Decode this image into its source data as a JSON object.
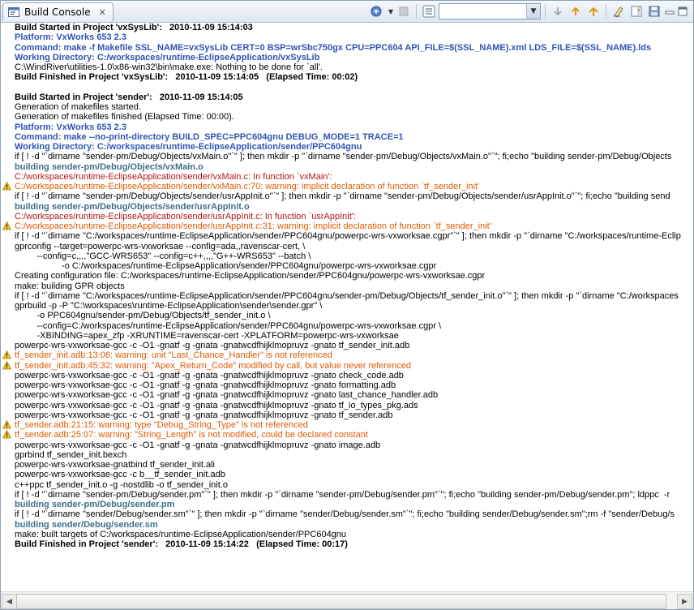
{
  "tab": {
    "title": "Build Console",
    "close": "✕"
  },
  "toolbar": {
    "combo_value": ""
  },
  "lines": [
    {
      "t": "Build Started in Project 'vxSysLib':   2010-11-09 15:14:03",
      "c": "bold"
    },
    {
      "t": "Platform: VxWorks 653 2.3",
      "c": "blue"
    },
    {
      "t": "Command: make -f Makefile SSL_NAME=vxSysLib CERT=0 BSP=wrSbc750gx CPU=PPC604 API_FILE=$(SSL_NAME).xml LDS_FILE=$(SSL_NAME).lds",
      "c": "blue"
    },
    {
      "t": "Working Directory: C:/workspaces/runtime-EclipseApplication/vxSysLib",
      "c": "blue"
    },
    {
      "t": "C:\\WindRiver\\utilities-1.0\\x86-win32\\bin\\make.exe: Nothing to be done for `all'.",
      "c": "black"
    },
    {
      "t": "Build Finished in Project 'vxSysLib':   2010-11-09 15:14:05   (Elapsed Time: 00:02)",
      "c": "bold"
    },
    {
      "t": "",
      "c": "black"
    },
    {
      "t": "Build Started in Project 'sender':   2010-11-09 15:14:05",
      "c": "bold"
    },
    {
      "t": "Generation of makefiles started.",
      "c": "black"
    },
    {
      "t": "Generation of makefiles finished (Elapsed Time: 00:00).",
      "c": "black"
    },
    {
      "t": "Platform: VxWorks 653 2.3",
      "c": "blue"
    },
    {
      "t": "Command: make --no-print-directory BUILD_SPEC=PPC604gnu DEBUG_MODE=1 TRACE=1",
      "c": "blue"
    },
    {
      "t": "Working Directory: C:/workspaces/runtime-EclipseApplication/sender/PPC604gnu",
      "c": "blue"
    },
    {
      "t": "if [ ! -d \"`dirname \"sender-pm/Debug/Objects/vxMain.o\"`\" ]; then mkdir -p \"`dirname \"sender-pm/Debug/Objects/vxMain.o\"`\"; fi;echo \"building sender-pm/Debug/Objects",
      "c": "black"
    },
    {
      "t": "building sender-pm/Debug/Objects/vxMain.o",
      "c": "gray"
    },
    {
      "t": "C:/workspaces/runtime-EclipseApplication/sender/vxMain.c: In function `vxMain':",
      "c": "red"
    },
    {
      "t": "C:/workspaces/runtime-EclipseApplication/sender/vxMain.c:70: warning: implicit declaration of function `tf_sender_init'",
      "c": "orange",
      "w": true
    },
    {
      "t": "if [ ! -d \"`dirname \"sender-pm/Debug/Objects/sender/usrAppInit.o\"`\" ]; then mkdir -p \"`dirname \"sender-pm/Debug/Objects/sender/usrAppInit.o\"`\"; fi;echo \"building send",
      "c": "black"
    },
    {
      "t": "building sender-pm/Debug/Objects/sender/usrAppInit.o",
      "c": "gray"
    },
    {
      "t": "C:/workspaces/runtime-EclipseApplication/sender/usrAppInit.c: In function `usrAppInit':",
      "c": "red"
    },
    {
      "t": "C:/workspaces/runtime-EclipseApplication/sender/usrAppInit.c:31: warning: implicit declaration of function `tf_sender_init'",
      "c": "orange",
      "w": true
    },
    {
      "t": "if [ ! -d \"`dirname \"C:/workspaces/runtime-EclipseApplication/sender/PPC604gnu/powerpc-wrs-vxworksae.cgpr\"`\" ]; then mkdir -p \"`dirname \"C:/workspaces/runtime-Eclip",
      "c": "black"
    },
    {
      "t": "gprconfig --target=powerpc-wrs-vxworksae --config=ada,,ravenscar-cert, \\",
      "c": "black"
    },
    {
      "t": "         --config=c,,,,\"GCC-WRS653\" --config=c++,,,,\"G++-WRS653\" --batch \\",
      "c": "black"
    },
    {
      "t": "                   -o C:/workspaces/runtime-EclipseApplication/sender/PPC604gnu/powerpc-wrs-vxworksae.cgpr",
      "c": "black"
    },
    {
      "t": "Creating configuration file: C:/workspaces/runtime-EclipseApplication/sender/PPC604gnu/powerpc-wrs-vxworksae.cgpr",
      "c": "black"
    },
    {
      "t": "make: building GPR objects",
      "c": "black"
    },
    {
      "t": "if [ ! -d \"`dirname \"C:/workspaces/runtime-EclipseApplication/sender/PPC604gnu/sender-pm/Debug/Objects/tf_sender_init.o\"`\" ]; then mkdir -p \"`dirname \"C:/workspaces",
      "c": "black"
    },
    {
      "t": "gprbuild -p -P \"C:\\workspaces\\runtime-EclipseApplication\\sender\\sender.gpr\" \\",
      "c": "black"
    },
    {
      "t": "         -o PPC604gnu/sender-pm/Debug/Objects/tf_sender_init.o \\",
      "c": "black"
    },
    {
      "t": "         --config=C:/workspaces/runtime-EclipseApplication/sender/PPC604gnu/powerpc-wrs-vxworksae.cgpr \\",
      "c": "black"
    },
    {
      "t": "         -XBINDING=apex_zfp -XRUNTIME=ravenscar-cert -XPLATFORM=powerpc-wrs-vxworksae",
      "c": "black"
    },
    {
      "t": "powerpc-wrs-vxworksae-gcc -c -O1 -gnatf -g -gnata -gnatwcdfhijklmopruvz -gnato tf_sender_init.adb",
      "c": "black"
    },
    {
      "t": "tf_sender_init.adb:13:06: warning: unit \"Last_Chance_Handler\" is not referenced",
      "c": "orange",
      "w": true
    },
    {
      "t": "tf_sender_init.adb:45:32: warning: \"Apex_Return_Code\" modified by call, but value never referenced",
      "c": "orange",
      "w": true
    },
    {
      "t": "powerpc-wrs-vxworksae-gcc -c -O1 -gnatf -g -gnata -gnatwcdfhijklmopruvz -gnato check_code.adb",
      "c": "black"
    },
    {
      "t": "powerpc-wrs-vxworksae-gcc -c -O1 -gnatf -g -gnata -gnatwcdfhijklmopruvz -gnato formatting.adb",
      "c": "black"
    },
    {
      "t": "powerpc-wrs-vxworksae-gcc -c -O1 -gnatf -g -gnata -gnatwcdfhijklmopruvz -gnato last_chance_handler.adb",
      "c": "black"
    },
    {
      "t": "powerpc-wrs-vxworksae-gcc -c -O1 -gnatf -g -gnata -gnatwcdfhijklmopruvz -gnato tf_io_types_pkg.ads",
      "c": "black"
    },
    {
      "t": "powerpc-wrs-vxworksae-gcc -c -O1 -gnatf -g -gnata -gnatwcdfhijklmopruvz -gnato tf_sender.adb",
      "c": "black"
    },
    {
      "t": "tf_sender.adb:21:15: warning: type \"Debug_String_Type\" is not referenced",
      "c": "orange",
      "w": true
    },
    {
      "t": "tf_sender.adb:25:07: warning: \"String_Length\" is not modified, could be declared constant",
      "c": "orange",
      "w": true
    },
    {
      "t": "powerpc-wrs-vxworksae-gcc -c -O1 -gnatf -g -gnata -gnatwcdfhijklmopruvz -gnato image.adb",
      "c": "black"
    },
    {
      "t": "gprbind tf_sender_init.bexch",
      "c": "black"
    },
    {
      "t": "powerpc-wrs-vxworksae-gnatbind tf_sender_init.ali",
      "c": "black"
    },
    {
      "t": "powerpc-wrs-vxworksae-gcc -c b__tf_sender_init.adb",
      "c": "black"
    },
    {
      "t": "c++ppc tf_sender_init.o -g -nostdlib -o tf_sender_init.o",
      "c": "black"
    },
    {
      "t": "if [ ! -d \"`dirname \"sender-pm/Debug/sender.pm\"`\" ]; then mkdir -p \"`dirname \"sender-pm/Debug/sender.pm\"`\"; fi;echo \"building sender-pm/Debug/sender.pm\"; ldppc  -r",
      "c": "black"
    },
    {
      "t": "building sender-pm/Debug/sender.pm",
      "c": "gray"
    },
    {
      "t": "if [ ! -d \"`dirname \"sender/Debug/sender.sm\"`\" ]; then mkdir -p \"`dirname \"sender/Debug/sender.sm\"`\"; fi;echo \"building sender/Debug/sender.sm\";rm -f \"sender/Debug/s",
      "c": "black"
    },
    {
      "t": "building sender/Debug/sender.sm",
      "c": "gray"
    },
    {
      "t": "make: built targets of C:/workspaces/runtime-EclipseApplication/sender/PPC604gnu",
      "c": "black"
    },
    {
      "t": "Build Finished in Project 'sender':   2010-11-09 15:14:22   (Elapsed Time: 00:17)",
      "c": "bold"
    }
  ]
}
